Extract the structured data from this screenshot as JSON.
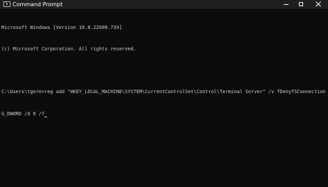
{
  "window": {
    "title": "Command Prompt"
  },
  "console": {
    "lines": [
      "Microsoft Windows [Version 10.0.22000.739]",
      "(c) Microsoft Corporation. All rights reserved.",
      "",
      "C:\\Users\\tgere>reg add \"HKEY_LOCAL_MACHINE\\SYSTEM\\CurrentControlSet\\Control\\Terminal Server\" /v fDenyTSConnections /t RE",
      "G_DWORD /d 0 /f"
    ]
  },
  "colors": {
    "background": "#0c0c0c",
    "titlebar": "#1f1f1f",
    "text": "#cccccc"
  }
}
